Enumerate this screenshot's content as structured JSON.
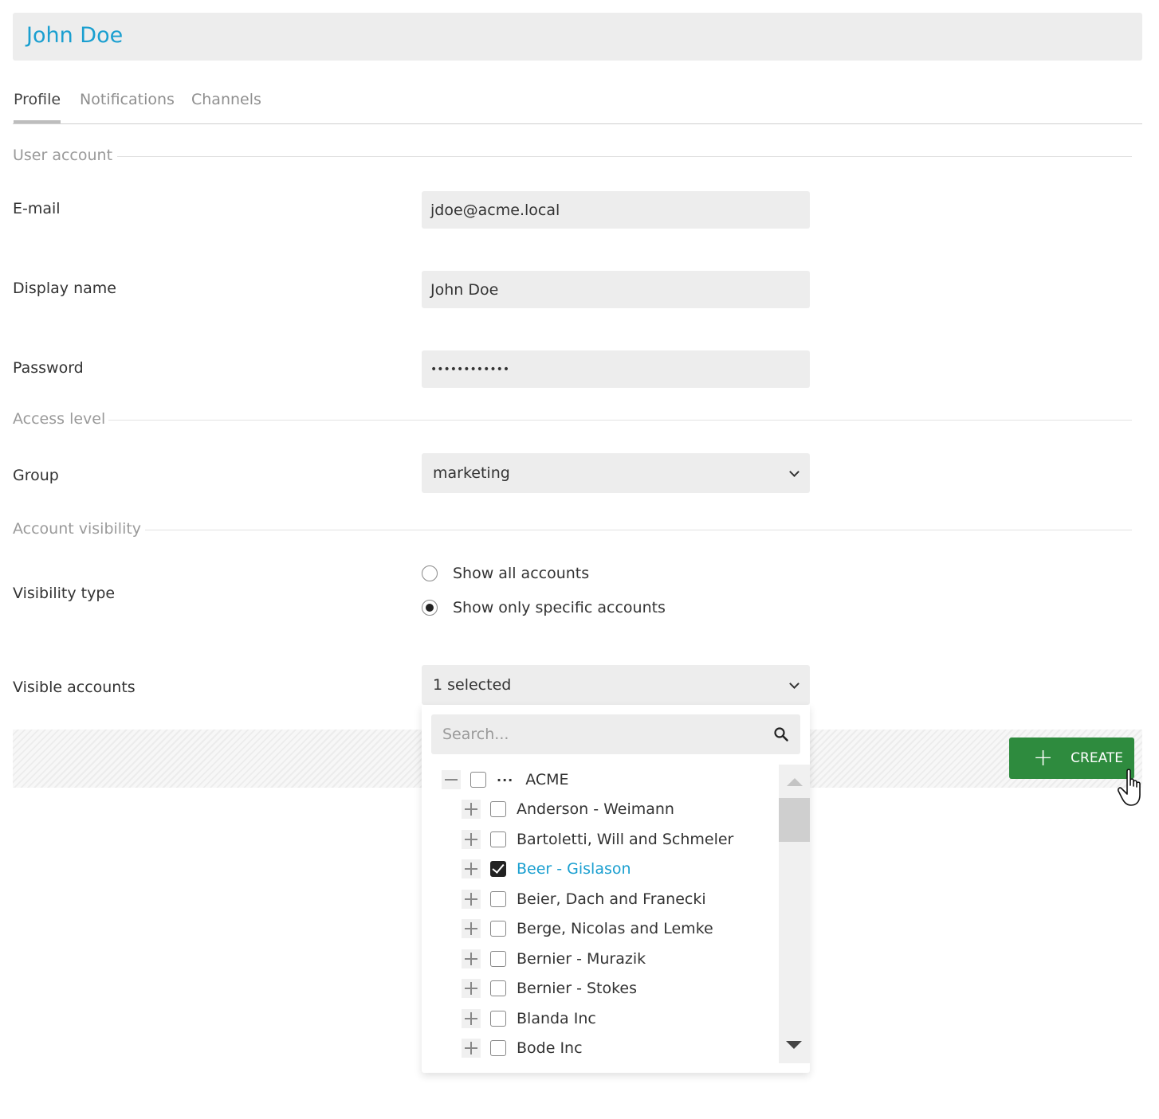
{
  "header": {
    "title": "John Doe"
  },
  "tabs": [
    {
      "label": "Profile",
      "active": true
    },
    {
      "label": "Notifications",
      "active": false
    },
    {
      "label": "Channels",
      "active": false
    }
  ],
  "sections": {
    "user_account": "User account",
    "access_level": "Access level",
    "account_visibility": "Account visibility"
  },
  "fields": {
    "email": {
      "label": "E-mail",
      "value": "jdoe@acme.local"
    },
    "display_name": {
      "label": "Display name",
      "value": "John Doe"
    },
    "password": {
      "label": "Password",
      "value": "••••••••••••"
    },
    "group": {
      "label": "Group",
      "value": "marketing"
    },
    "visibility_type": {
      "label": "Visibility type",
      "options": [
        {
          "label": "Show all accounts",
          "checked": false
        },
        {
          "label": "Show only specific accounts",
          "checked": true
        }
      ]
    },
    "visible_accounts": {
      "label": "Visible accounts",
      "value": "1 selected"
    }
  },
  "dropdown": {
    "search_placeholder": "Search...",
    "root": {
      "label": "ACME",
      "checked": false
    },
    "items": [
      {
        "label": "Anderson - Weimann",
        "checked": false
      },
      {
        "label": "Bartoletti, Will and Schmeler",
        "checked": false
      },
      {
        "label": "Beer - Gislason",
        "checked": true
      },
      {
        "label": "Beier, Dach and Franecki",
        "checked": false
      },
      {
        "label": "Berge, Nicolas and Lemke",
        "checked": false
      },
      {
        "label": "Bernier - Murazik",
        "checked": false
      },
      {
        "label": "Bernier - Stokes",
        "checked": false
      },
      {
        "label": "Blanda Inc",
        "checked": false
      },
      {
        "label": "Bode Inc",
        "checked": false
      }
    ]
  },
  "actions": {
    "create_label": "CREATE"
  },
  "colors": {
    "accent": "#1a9fd0",
    "create_button": "#2e8b3e"
  }
}
